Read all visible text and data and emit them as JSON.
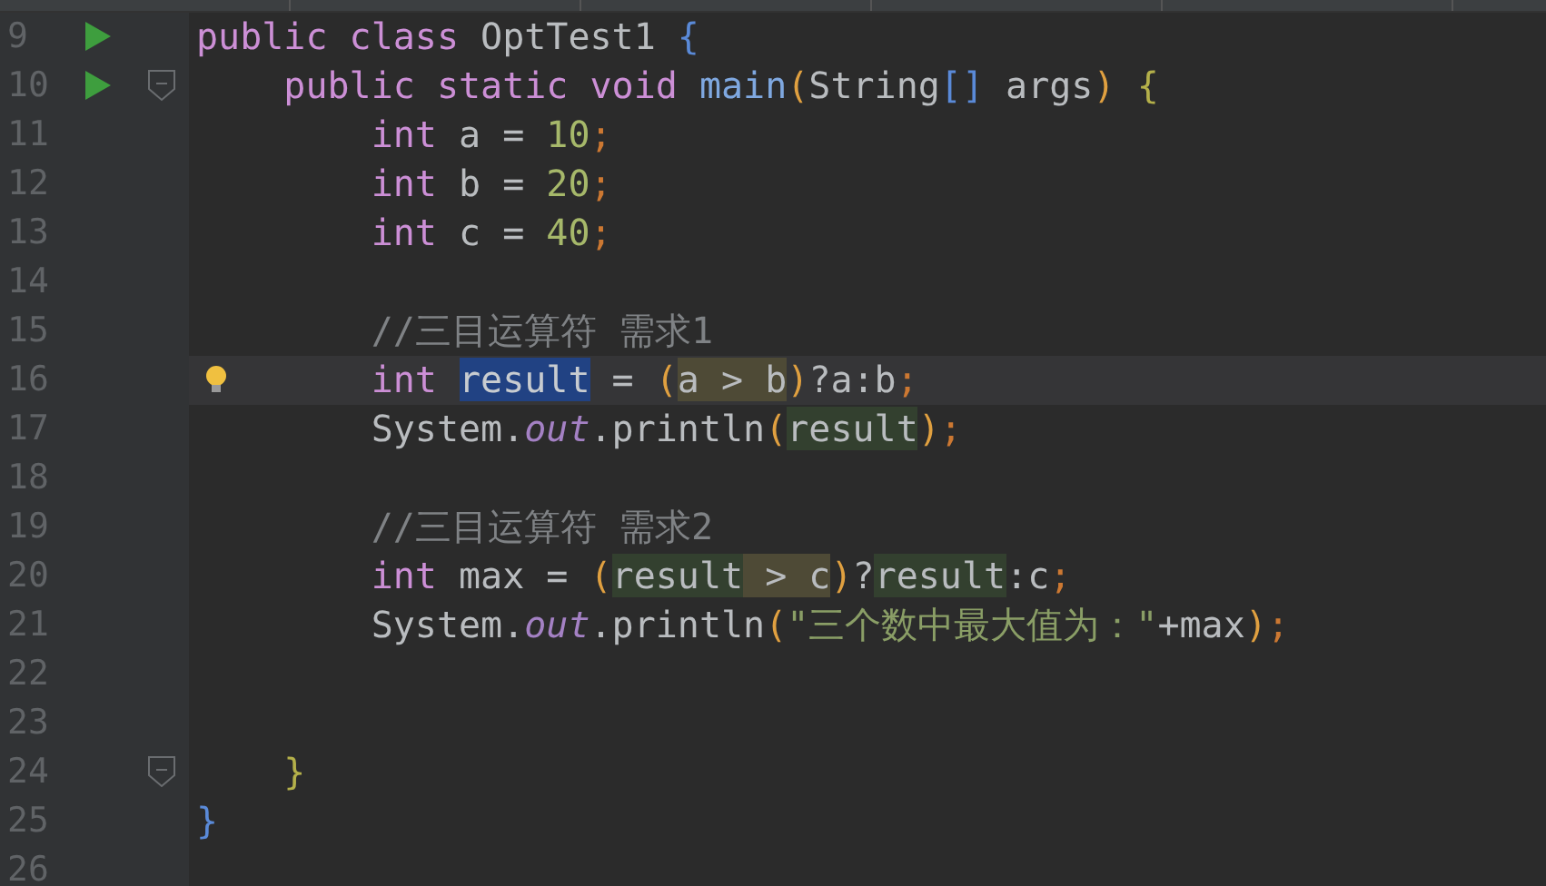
{
  "tabs": [
    {
      "selected": false
    },
    {
      "selected": false
    },
    {
      "selected": false
    },
    {
      "selected": false
    },
    {
      "selected": false
    }
  ],
  "lines": [
    {
      "number": "9",
      "run": true,
      "fold": false,
      "bulb": false,
      "current": false,
      "tokens": [
        {
          "text": "public class ",
          "kind": "keyword"
        },
        {
          "text": "OptTest1 ",
          "kind": "plain"
        },
        {
          "text": "{",
          "kind": "brace2"
        }
      ]
    },
    {
      "number": "10",
      "run": true,
      "fold": true,
      "bulb": false,
      "current": false,
      "tokens": [
        {
          "text": "    public static void ",
          "kind": "keyword"
        },
        {
          "text": "main",
          "kind": "method"
        },
        {
          "text": "(",
          "kind": "paren"
        },
        {
          "text": "String",
          "kind": "plain"
        },
        {
          "text": "[]",
          "kind": "brace2"
        },
        {
          "text": " args",
          "kind": "plain"
        },
        {
          "text": ")",
          "kind": "paren"
        },
        {
          "text": " {",
          "kind": "brace1"
        }
      ]
    },
    {
      "number": "11",
      "run": false,
      "fold": false,
      "bulb": false,
      "current": false,
      "tokens": [
        {
          "text": "        int ",
          "kind": "keyword"
        },
        {
          "text": "a = ",
          "kind": "plain"
        },
        {
          "text": "10",
          "kind": "number"
        },
        {
          "text": ";",
          "kind": "punct"
        }
      ]
    },
    {
      "number": "12",
      "run": false,
      "fold": false,
      "bulb": false,
      "current": false,
      "tokens": [
        {
          "text": "        int ",
          "kind": "keyword"
        },
        {
          "text": "b = ",
          "kind": "plain"
        },
        {
          "text": "20",
          "kind": "number"
        },
        {
          "text": ";",
          "kind": "punct"
        }
      ]
    },
    {
      "number": "13",
      "run": false,
      "fold": false,
      "bulb": false,
      "current": false,
      "tokens": [
        {
          "text": "        int ",
          "kind": "keyword"
        },
        {
          "text": "c = ",
          "kind": "plain"
        },
        {
          "text": "40",
          "kind": "number"
        },
        {
          "text": ";",
          "kind": "punct"
        }
      ]
    },
    {
      "number": "14",
      "run": false,
      "fold": false,
      "bulb": false,
      "current": false
    },
    {
      "number": "15",
      "run": false,
      "fold": false,
      "bulb": false,
      "current": false,
      "tokens": [
        {
          "text": "        //三目运算符 需求1",
          "kind": "comment"
        }
      ]
    },
    {
      "number": "16",
      "run": false,
      "fold": false,
      "bulb": true,
      "current": true,
      "tokens": [
        {
          "text": "        int ",
          "kind": "keyword"
        },
        {
          "text": "result",
          "kind": "selection"
        },
        {
          "text": " = ",
          "kind": "plain"
        },
        {
          "text": "(",
          "kind": "paren"
        },
        {
          "text": "a > b",
          "kind": "match"
        },
        {
          "text": ")",
          "kind": "paren"
        },
        {
          "text": "?a:b",
          "kind": "plain"
        },
        {
          "text": ";",
          "kind": "punct"
        }
      ]
    },
    {
      "number": "17",
      "run": false,
      "fold": false,
      "bulb": false,
      "current": false,
      "tokens": [
        {
          "text": "        System.",
          "kind": "plain"
        },
        {
          "text": "out",
          "kind": "field"
        },
        {
          "text": ".println",
          "kind": "plain"
        },
        {
          "text": "(",
          "kind": "paren"
        },
        {
          "text": "result",
          "kind": "usage"
        },
        {
          "text": ")",
          "kind": "paren"
        },
        {
          "text": ";",
          "kind": "punct"
        }
      ]
    },
    {
      "number": "18",
      "run": false,
      "fold": false,
      "bulb": false,
      "current": false
    },
    {
      "number": "19",
      "run": false,
      "fold": false,
      "bulb": false,
      "current": false,
      "tokens": [
        {
          "text": "        //三目运算符 需求2",
          "kind": "comment"
        }
      ]
    },
    {
      "number": "20",
      "run": false,
      "fold": false,
      "bulb": false,
      "current": false,
      "tokens": [
        {
          "text": "        int ",
          "kind": "keyword"
        },
        {
          "text": "max = ",
          "kind": "plain"
        },
        {
          "text": "(",
          "kind": "paren"
        },
        {
          "text": "result",
          "kind": "usage"
        },
        {
          "text": " > c",
          "kind": "match"
        },
        {
          "text": ")",
          "kind": "paren"
        },
        {
          "text": "?",
          "kind": "plain"
        },
        {
          "text": "result",
          "kind": "usage"
        },
        {
          "text": ":c",
          "kind": "plain"
        },
        {
          "text": ";",
          "kind": "punct"
        }
      ]
    },
    {
      "number": "21",
      "run": false,
      "fold": false,
      "bulb": false,
      "current": false,
      "tokens": [
        {
          "text": "        System.",
          "kind": "plain"
        },
        {
          "text": "out",
          "kind": "field"
        },
        {
          "text": ".println",
          "kind": "plain"
        },
        {
          "text": "(",
          "kind": "paren"
        },
        {
          "text": "\"三个数中最大值为：\"",
          "kind": "string"
        },
        {
          "text": "+max",
          "kind": "plain"
        },
        {
          "text": ")",
          "kind": "paren"
        },
        {
          "text": ";",
          "kind": "punct"
        }
      ]
    },
    {
      "number": "22",
      "run": false,
      "fold": false,
      "bulb": false,
      "current": false
    },
    {
      "number": "23",
      "run": false,
      "fold": false,
      "bulb": false,
      "current": false
    },
    {
      "number": "24",
      "run": false,
      "fold": true,
      "bulb": false,
      "current": false,
      "tokens": [
        {
          "text": "    }",
          "kind": "brace1"
        }
      ]
    },
    {
      "number": "25",
      "run": false,
      "fold": false,
      "bulb": false,
      "current": false,
      "tokens": [
        {
          "text": "}",
          "kind": "brace2"
        }
      ]
    },
    {
      "number": "26",
      "run": false,
      "fold": false,
      "bulb": false,
      "current": false
    }
  ]
}
